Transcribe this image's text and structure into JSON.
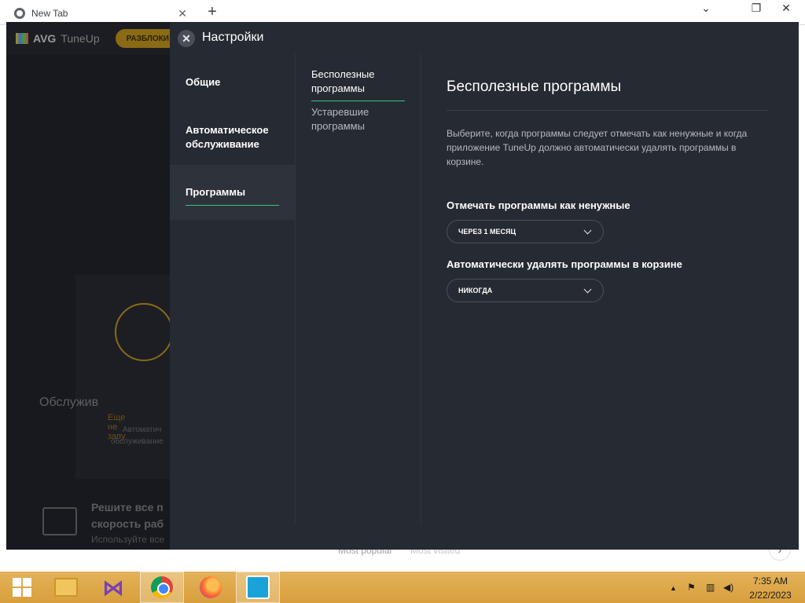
{
  "browser": {
    "tab_title": "New Tab",
    "tab_close": "✕",
    "new_tab": "+",
    "minimize": "⌄",
    "restore": "❐",
    "close": "✕",
    "most_popular": "Most popular",
    "most_visited": "Most visited",
    "next": "›"
  },
  "avg_background": {
    "logo_brand": "AVG",
    "logo_product": "TuneUp",
    "unlock_button": "РАЗБЛОКИ",
    "card_title": "Обслужив",
    "card_status": "Еще не запу",
    "card_desc_line1": "Автоматич",
    "card_desc_line2": "обслуживание",
    "bottom_line1": "Решите все п",
    "bottom_line2": "скорость раб",
    "bottom_line3": "Используйте все"
  },
  "settings": {
    "title": "Настройки",
    "close_glyph": "✕",
    "nav": {
      "general": "Общие",
      "auto_maintenance": "Автоматическое обслуживание",
      "programs": "Программы"
    },
    "subnav": {
      "useless": "Бесполезные программы",
      "outdated": "Устаревшие программы"
    },
    "content": {
      "title": "Бесполезные программы",
      "description": "Выберите, когда программы следует отмечать как ненужные и когда приложение TuneUp должно автоматически удалять программы в корзине.",
      "mark_label": "Отмечать программы как ненужные",
      "mark_value": "ЧЕРЕЗ 1 МЕСЯЦ",
      "delete_label": "Автоматически удалять программы в корзине",
      "delete_value": "НИКОГДА"
    },
    "accent_color": "#35c48a"
  },
  "taskbar": {
    "items": [
      "start",
      "file-explorer",
      "visual-studio",
      "chrome",
      "firefox",
      "avg-tuneup"
    ],
    "vs_glyph": "⋈",
    "tray_show_hidden": "▲",
    "tray_flag": "⚑",
    "tray_network": "▥",
    "tray_volume": "◀)",
    "time": "7:35 AM",
    "date": "2/22/2023"
  }
}
